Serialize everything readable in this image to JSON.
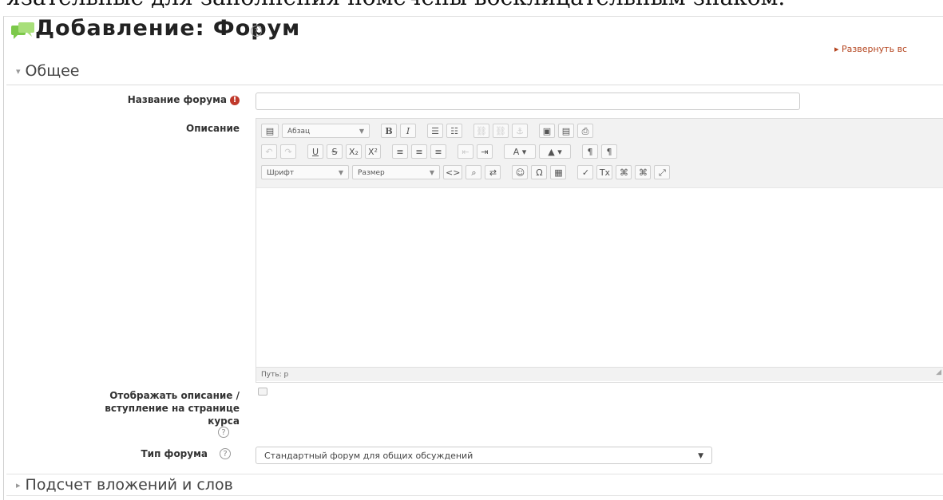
{
  "top_strip_text": "язательные для заполнения помечены восклицательным знаком.",
  "page": {
    "title": "Добавление: Форум",
    "title_icon": "forum-icon",
    "help_icon": "help-icon",
    "expand_all": "▸ Развернуть вс"
  },
  "section_general": {
    "title": "Общее",
    "indicator": "▾"
  },
  "fields": {
    "forum_name": {
      "label": "Название форума",
      "value": "",
      "required_icon": "exclamation-icon"
    },
    "description": {
      "label": "Описание"
    },
    "show_description": {
      "label_line1": "Отображать описание /",
      "label_line2": "вступление на странице",
      "label_line3": "курса",
      "checked": false
    },
    "forum_type": {
      "label": "Тип форума",
      "value": "Стандартный форум для общих обсуждений"
    }
  },
  "editor": {
    "row1": {
      "toggle_icon": "toolbar-toggle-icon",
      "paragraph_select": "Абзац",
      "bold": "B",
      "italic": "I",
      "bullet_list": "☰",
      "numbered_list": "☷",
      "link": "⛓",
      "unlink": "⛓",
      "anchor": "⚓",
      "image": "▣",
      "media": "▤",
      "file": "⎙"
    },
    "row2": {
      "undo": "↶",
      "redo": "↷",
      "underline": "U",
      "strike": "S",
      "subscript": "X₂",
      "superscript": "X²",
      "align_left": "≡",
      "align_center": "≡",
      "align_right": "≡",
      "outdent": "⇤",
      "indent": "⇥",
      "text_color": "A",
      "bg_color": "▲",
      "ltr": "¶",
      "rtl": "¶"
    },
    "row3": {
      "font_select": "Шрифт",
      "size_select": "Размер",
      "html": "<>",
      "find": "⌕",
      "replace": "⇄",
      "emoticons": "☺",
      "special_char": "Ω",
      "table": "▦",
      "cleanup": "✓",
      "remove_format": "Tx",
      "spell1": "⌘",
      "spell2": "⌘",
      "fullscreen": "⤢"
    },
    "path": "Путь: p",
    "resize_glyph": "◢"
  },
  "section_attachments": {
    "title": "Подсчет вложений и слов",
    "indicator": "▸"
  },
  "colors": {
    "title_icon": "#7cc94a",
    "link": "#b4451f",
    "required": "#c0392b",
    "toolbar_bg": "#f2f2f2"
  }
}
